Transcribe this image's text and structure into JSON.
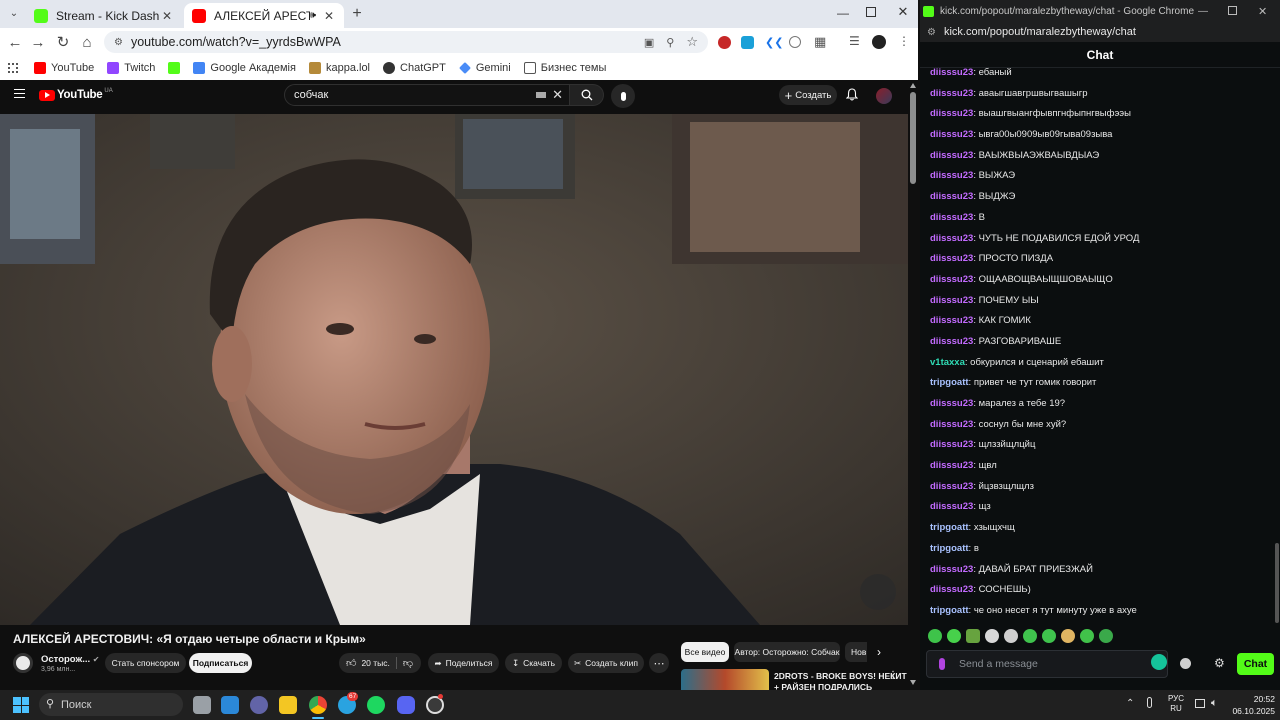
{
  "left_browser": {
    "tabs": [
      {
        "title": "Stream - Kick Dashboard",
        "active": false
      },
      {
        "title": "АЛЕКСЕЙ АРЕСТОВИЧ: «Я",
        "active": true
      }
    ],
    "url": "youtube.com/watch?v=_yyrdsBwWPA",
    "bookmarks": [
      "YouTube",
      "Twitch",
      "Google Академія",
      "kappa.lol",
      "ChatGPT",
      "Gemini",
      "Бизнес темы"
    ]
  },
  "youtube": {
    "logo_text": "YouTube",
    "region": "UA",
    "search_value": "собчак",
    "create_label": "Создать",
    "video_title": "АЛЕКСЕЙ АРЕСТОВИЧ: «Я отдаю четыре области и Крым»",
    "channel_name": "Осторож...",
    "subscribers": "3,96 млн...",
    "sponsor_label": "Стать спонсором",
    "subscribe_label": "Подписаться",
    "likes": "20 тыс.",
    "share_label": "Поделиться",
    "download_label": "Скачать",
    "clip_label": "Создать клип",
    "chips": [
      "Все видео",
      "Автор: Осторожно: Собчак",
      "Нов"
    ],
    "related_title": "2DROTS - BROKE BOYS! НЕКИТ",
    "related_subtitle": "+ РАЙЗЕН ПОДРАЛИСЬ"
  },
  "right_browser": {
    "window_title": "kick.com/popout/maralezbytheway/chat - Google Chrome",
    "url": "kick.com/popout/maralezbytheway/chat",
    "chat_title": "Chat",
    "input_placeholder": "Send a message",
    "send_label": "Chat",
    "colors": {
      "diisssu23": "#c36bff",
      "v1taxxa": "#2fdcb5",
      "tripgoatt": "#a9c2ff",
      "accent": "#53fc18"
    },
    "messages": [
      {
        "user": "diisssu23",
        "text": "ебаный"
      },
      {
        "user": "diisssu23",
        "text": "аваыгшавгршвыгвашыгр"
      },
      {
        "user": "diisssu23",
        "text": "выашгвыангфывпгнфыпнгвыфээы"
      },
      {
        "user": "diisssu23",
        "text": "ывга00ы0909ыв09гыва09зыва"
      },
      {
        "user": "diisssu23",
        "text": "ВАЫЖВЫАЭЖВАЫВДЫАЭ"
      },
      {
        "user": "diisssu23",
        "text": "ВЫЖАЭ"
      },
      {
        "user": "diisssu23",
        "text": "ВЫДЖЭ"
      },
      {
        "user": "diisssu23",
        "text": "В"
      },
      {
        "user": "diisssu23",
        "text": "ЧУТЬ НЕ ПОДАВИЛСЯ ЕДОЙ УРОД"
      },
      {
        "user": "diisssu23",
        "text": "ПРОСТО ПИЗДА"
      },
      {
        "user": "diisssu23",
        "text": "ОЩААВОЩВАЫЩШОВАЫЩО"
      },
      {
        "user": "diisssu23",
        "text": "ПОЧЕМУ ЫЫ"
      },
      {
        "user": "diisssu23",
        "text": "КАК ГОМИК"
      },
      {
        "user": "diisssu23",
        "text": "РАЗГОВАРИВАШЕ"
      },
      {
        "user": "v1taxxa",
        "text": "обкурился и сценарий ебашит"
      },
      {
        "user": "tripgoatt",
        "text": "привет че тут гомик говорит"
      },
      {
        "user": "diisssu23",
        "text": "маралез а тебе 19?"
      },
      {
        "user": "diisssu23",
        "text": "соснул бы мне хуй?"
      },
      {
        "user": "diisssu23",
        "text": "щлззйщлцйц"
      },
      {
        "user": "diisssu23",
        "text": "щвл"
      },
      {
        "user": "diisssu23",
        "text": "йцзвзщлщлз"
      },
      {
        "user": "diisssu23",
        "text": "щз"
      },
      {
        "user": "tripgoatt",
        "text": "хзыщхчщ"
      },
      {
        "user": "tripgoatt",
        "text": "в"
      },
      {
        "user": "diisssu23",
        "text": "ДАВАЙ БРАТ ПРИЕЗЖАЙ"
      },
      {
        "user": "diisssu23",
        "text": "СОСНЕШЬ)"
      },
      {
        "user": "tripgoatt",
        "text": "че оно несет я тут минуту уже в ахуе"
      }
    ]
  },
  "taskbar": {
    "search_placeholder": "Поиск",
    "telegram_badge": "67",
    "lang_top": "РУС",
    "lang_bottom": "RU",
    "time": "20:52",
    "date": "06.10.2025"
  }
}
